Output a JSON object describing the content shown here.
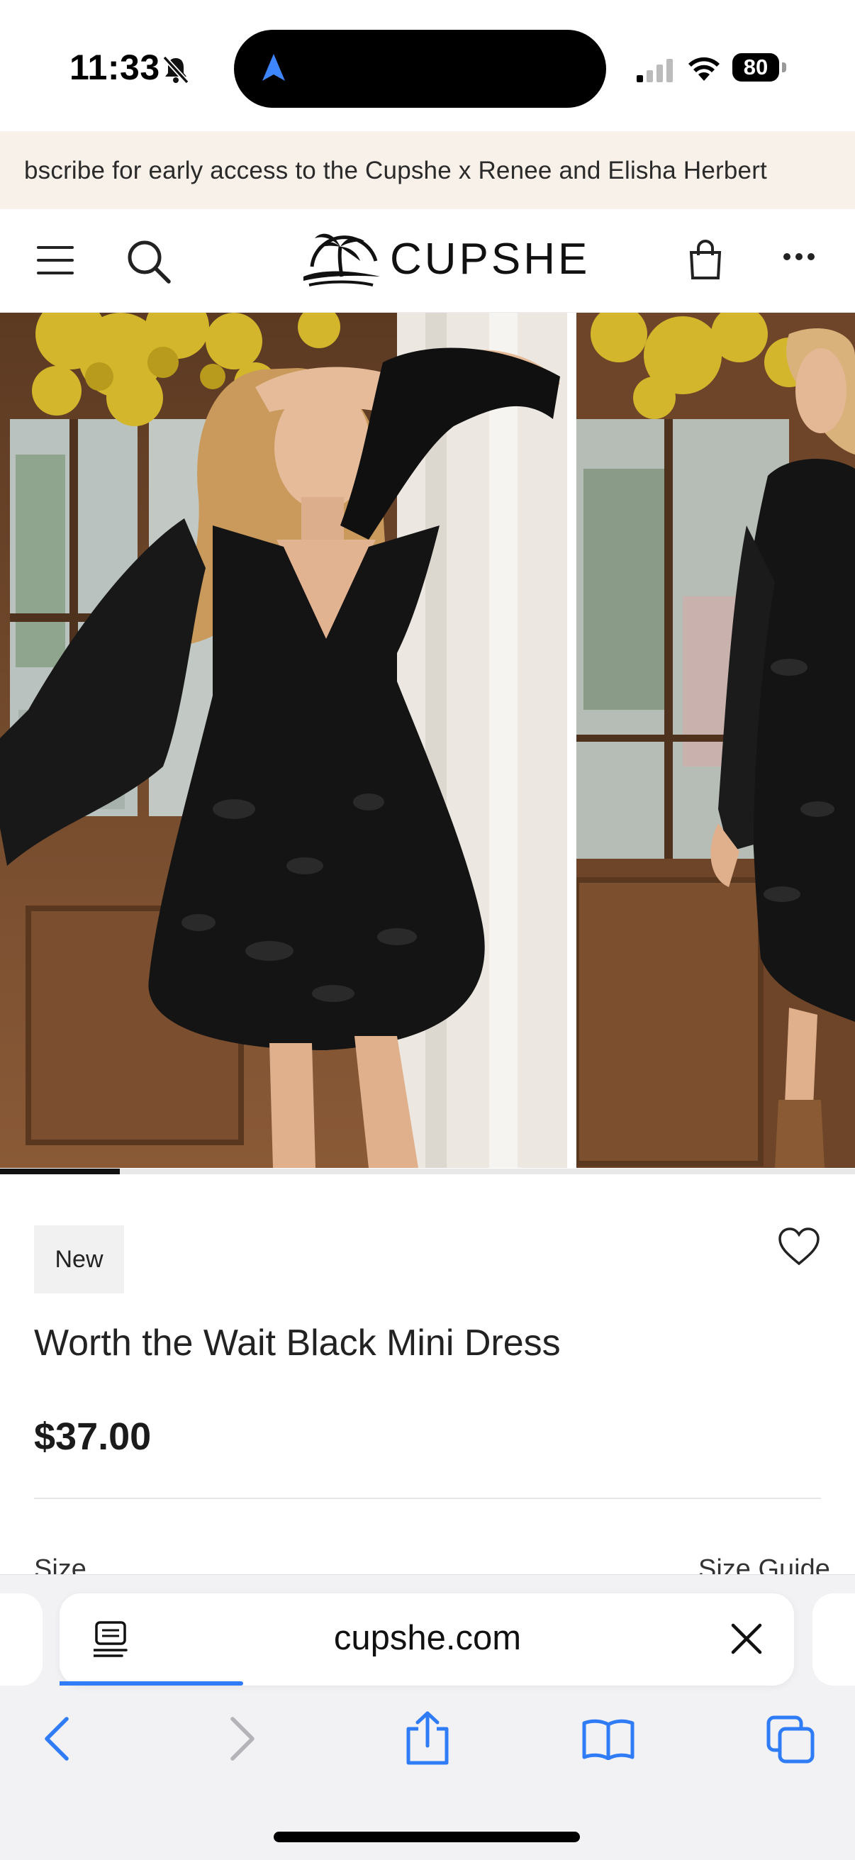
{
  "status_bar": {
    "time": "11:33",
    "battery": "80",
    "icons": [
      "bell-slash-icon",
      "location-arrow-icon",
      "signal-icon",
      "wifi-icon",
      "battery-icon"
    ]
  },
  "promo": {
    "text": "bscribe for early access to the Cupshe x Renee and Elisha Herbert"
  },
  "header": {
    "logo": "CUPSHE",
    "icons": [
      "menu-icon",
      "search-icon",
      "palm-logo-icon",
      "bag-icon",
      "more-icon"
    ]
  },
  "gallery": {
    "progress": 0.14,
    "images": [
      "model-front-photo",
      "model-side-photo"
    ]
  },
  "product": {
    "badge": "New",
    "title": "Worth the Wait Black Mini Dress",
    "price": "$37.00",
    "size_label": "Size",
    "size_guide": "Size Guide"
  },
  "browser": {
    "url": "cupshe.com",
    "load_progress": 0.25,
    "accent": "#2f7cf6",
    "toolbar": [
      "back-icon",
      "forward-icon",
      "share-icon",
      "bookmarks-icon",
      "tabs-icon"
    ]
  }
}
